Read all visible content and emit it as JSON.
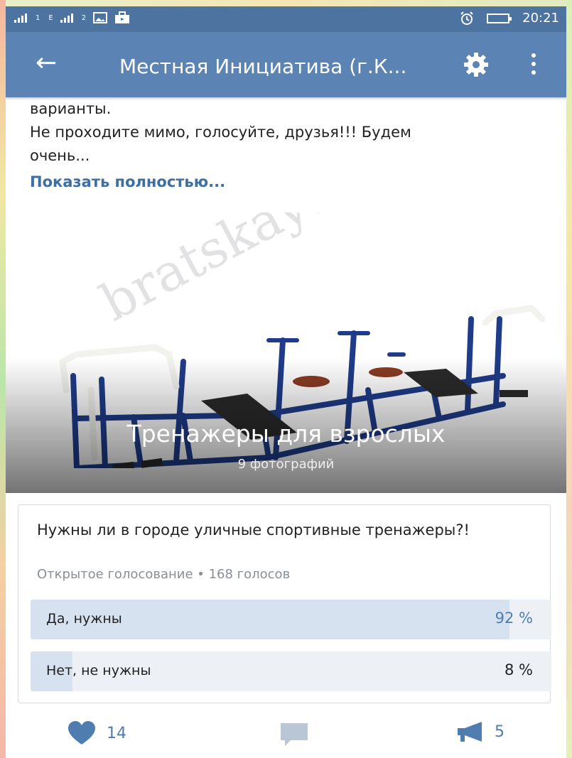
{
  "status_bar": {
    "sim1_label": "1",
    "sim2_label": "2",
    "sim2_network": "E",
    "time": "20:21",
    "icons": [
      "signal-icon",
      "signal-icon",
      "image-icon",
      "briefcase-icon",
      "alarm-icon",
      "battery-icon"
    ]
  },
  "app_bar": {
    "title": "Местная Инициатива (г.К...",
    "icons": [
      "back-arrow-icon",
      "gear-icon",
      "more-vert-icon"
    ]
  },
  "post": {
    "text_line1": "варианты.",
    "text_line2": "Не проходите мимо, голосуйте, друзья!!! Будем",
    "text_line3": "очень...",
    "show_more": "Показать полностью..."
  },
  "album": {
    "title": "Тренажеры для взрослых",
    "count": "9 фотографий",
    "watermark": "bratskaya.ru"
  },
  "poll": {
    "question": "Нужны ли в городе уличные спортивные тренажеры?!",
    "meta": "Открытое голосование • 168 голосов",
    "options": [
      {
        "label": "Да, нужны",
        "percent_text": "92 %",
        "percent": 92
      },
      {
        "label": "Нет, не нужны",
        "percent_text": "8 %",
        "percent": 8
      }
    ]
  },
  "footer": {
    "likes": "14",
    "reposts": "5",
    "icons": [
      "heart-icon",
      "comment-icon",
      "megaphone-icon"
    ]
  },
  "colors": {
    "status_bar": "#4d73a0",
    "app_bar": "#5b83b3",
    "link": "#3d6ea4",
    "accent": "#4f7db0",
    "poll_fill": "#d6e2ef",
    "poll_track": "#edf1f5"
  }
}
